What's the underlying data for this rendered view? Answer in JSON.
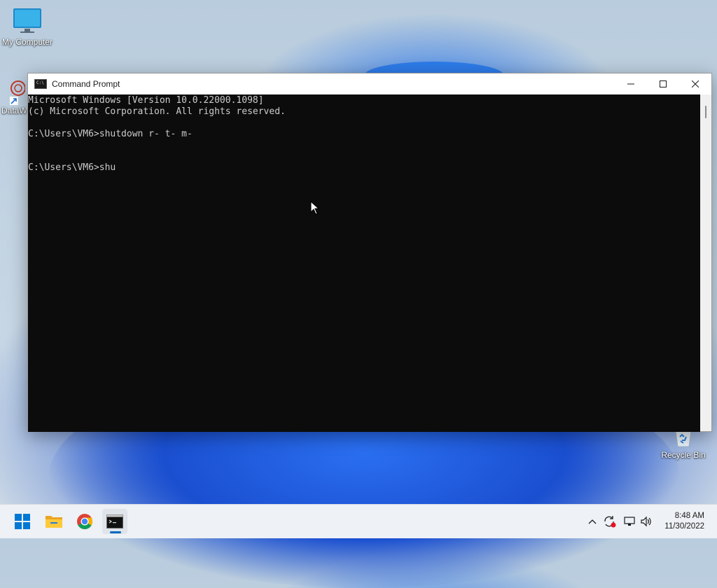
{
  "desktop": {
    "icons": [
      {
        "label": "My Computer",
        "icon": "monitor-icon"
      },
      {
        "label": "DataW",
        "icon": "app-shortcut-icon"
      },
      {
        "label": "Recycle Bin",
        "icon": "recycle-bin-icon"
      }
    ]
  },
  "window": {
    "title": "Command Prompt",
    "icon": "cmd-icon",
    "controls": [
      "minimize-icon",
      "maximize-icon",
      "close-icon"
    ],
    "console_lines": [
      "Microsoft Windows [Version 10.0.22000.1098]",
      "(c) Microsoft Corporation. All rights reserved.",
      "",
      "C:\\Users\\VM6>shutdown r- t- m-",
      "",
      "",
      "C:\\Users\\VM6>shu"
    ]
  },
  "taskbar": {
    "apps": [
      "windows-start-icon",
      "file-explorer-icon",
      "chrome-icon",
      "cmd-icon"
    ],
    "tray": [
      "chevron-up-icon",
      "sync-icon",
      "network-icon",
      "volume-icon"
    ],
    "time": "8:48 AM",
    "date": "11/30/2022"
  },
  "colors": {
    "console_bg": "#0c0c0c",
    "console_text": "#cccccc",
    "accent": "#0067c0"
  }
}
